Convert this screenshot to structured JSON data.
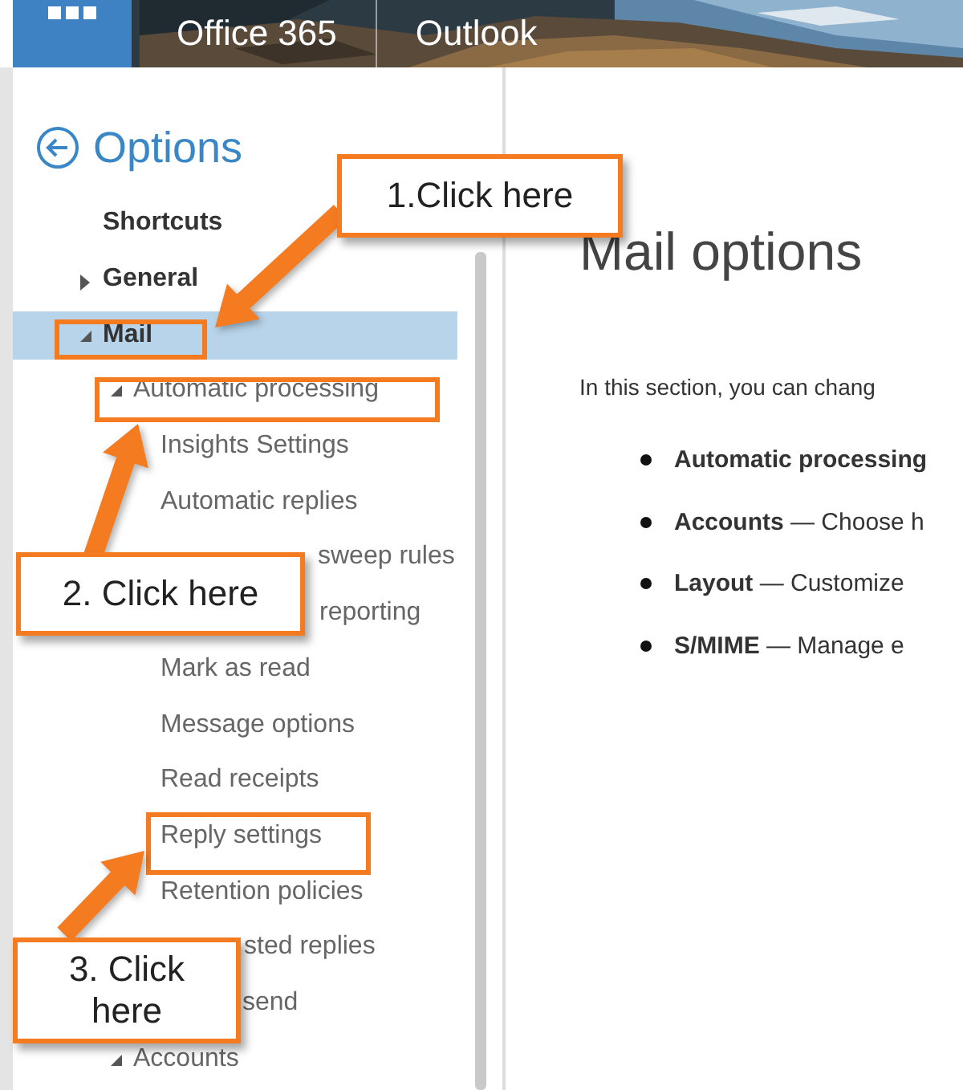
{
  "header": {
    "suite": "Office 365",
    "app": "Outlook"
  },
  "nav": {
    "title": "Options",
    "items": [
      {
        "label": "Shortcuts",
        "selected": false
      },
      {
        "label": "General",
        "selected": false,
        "expanded": false
      },
      {
        "label": "Mail",
        "selected": true,
        "expanded": true,
        "children": [
          {
            "label": "Automatic processing",
            "selected": false,
            "expanded": true,
            "children": [
              {
                "label": "Insights Settings",
                "selected": false,
                "kind": "link"
              },
              {
                "label": "Automatic replies",
                "selected": false,
                "kind": "link"
              },
              {
                "label": "sweep rules",
                "selected": false,
                "kind": "covered"
              },
              {
                "label": "reporting",
                "selected": false,
                "kind": "covered"
              },
              {
                "label": "Mark as read",
                "selected": false,
                "kind": "link"
              },
              {
                "label": "Message options",
                "selected": false,
                "kind": "link"
              },
              {
                "label": "Read receipts",
                "selected": false,
                "kind": "link"
              },
              {
                "label": "Reply settings",
                "selected": false,
                "kind": "link"
              },
              {
                "label": "Retention policies",
                "selected": false,
                "kind": "link"
              },
              {
                "label": "sted replies",
                "selected": false,
                "kind": "covered"
              },
              {
                "label": "send",
                "selected": false,
                "kind": "covered"
              }
            ]
          },
          {
            "label": "Accounts",
            "selected": false,
            "expanded": true
          }
        ]
      }
    ]
  },
  "main": {
    "title": "Mail options",
    "intro": "In this section, you can chang",
    "bullets": [
      {
        "term": "Automatic processing"
      },
      {
        "term": "Accounts",
        "description": "— Choose h"
      },
      {
        "term": "Layout",
        "description": "— Customize"
      },
      {
        "term": "S/MIME",
        "description": "— Manage e"
      }
    ]
  },
  "callouts": [
    {
      "text": "1.Click here"
    },
    {
      "text": "2. Click here"
    },
    {
      "text": "3. Click here"
    }
  ]
}
